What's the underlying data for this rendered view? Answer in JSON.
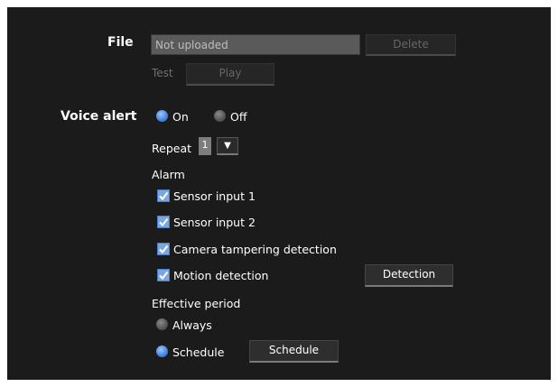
{
  "file": {
    "label": "File",
    "value": "Not uploaded",
    "delete_label": "Delete",
    "test_label": "Test",
    "play_label": "Play"
  },
  "voice_alert": {
    "label": "Voice alert",
    "on_label": "On",
    "off_label": "Off",
    "selected": "On"
  },
  "repeat": {
    "label": "Repeat",
    "value": "1"
  },
  "alarm": {
    "label": "Alarm",
    "items": [
      {
        "label": "Sensor input 1",
        "checked": true
      },
      {
        "label": "Sensor input 2",
        "checked": true
      },
      {
        "label": "Camera tampering detection",
        "checked": true
      },
      {
        "label": "Motion detection",
        "checked": true
      }
    ],
    "detection_button": "Detection"
  },
  "effective_period": {
    "label": "Effective period",
    "always_label": "Always",
    "schedule_label": "Schedule",
    "schedule_button": "Schedule",
    "selected": "Schedule"
  },
  "colors": {
    "panel_bg": "#1b1b1b",
    "accent_blue": "#4b88e2",
    "check_blue": "#7aa7e0"
  }
}
